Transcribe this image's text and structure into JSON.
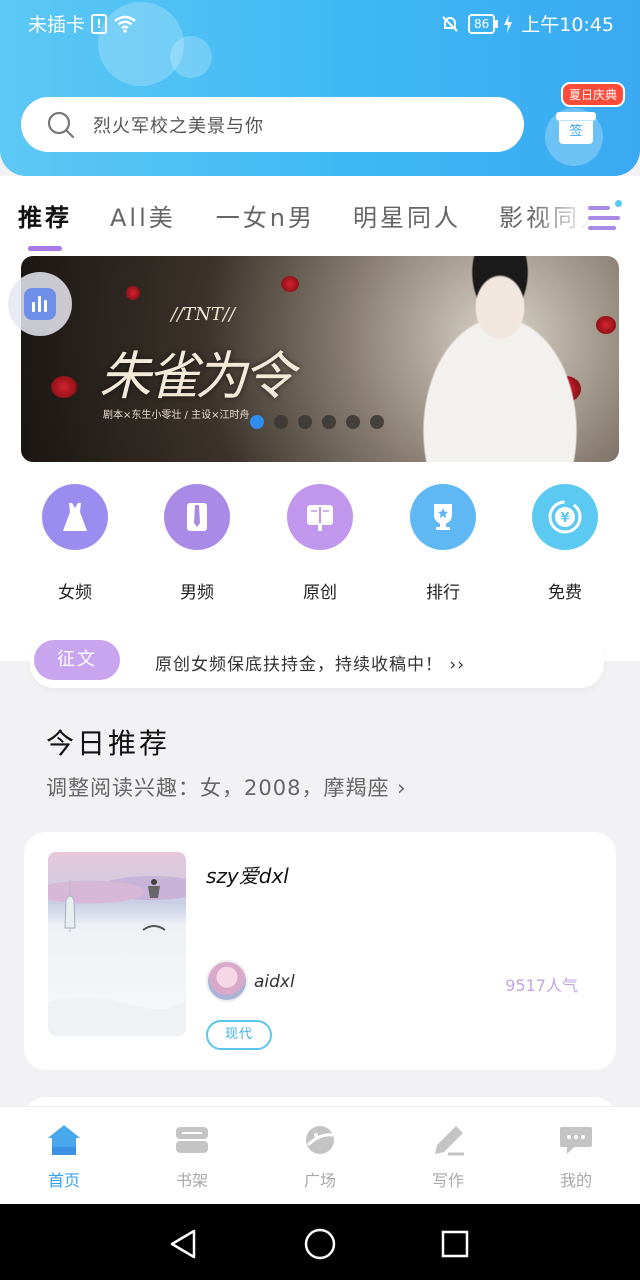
{
  "status_bar": {
    "carrier": "未插卡",
    "battery": "86",
    "time": "上午10:45"
  },
  "search": {
    "placeholder": "烈火军校之美景与你"
  },
  "signin": {
    "badge": "夏日庆典",
    "label": "签"
  },
  "tabs": [
    {
      "label": "推荐"
    },
    {
      "label": "All美"
    },
    {
      "label": "一女n男"
    },
    {
      "label": "明星同人"
    },
    {
      "label": "影视同人"
    }
  ],
  "banner": {
    "tnt": "//TNT//",
    "title": "朱雀为令",
    "credits": "剧本×东生小零壮 / 主设×江时舟"
  },
  "categories": [
    {
      "label": "女频",
      "icon": "dress-icon",
      "color": "#9b8df0"
    },
    {
      "label": "男频",
      "icon": "shirt-icon",
      "color": "#a98ae6"
    },
    {
      "label": "原创",
      "icon": "book-icon",
      "color": "#c197ee"
    },
    {
      "label": "排行",
      "icon": "trophy-icon",
      "color": "#5fb8f4"
    },
    {
      "label": "免费",
      "icon": "yen-coin-icon",
      "color": "#5cc9f2"
    }
  ],
  "notice": {
    "tag": "征文",
    "text": "原创女频保底扶持金，持续收稿中！ ››"
  },
  "recommend": {
    "title": "今日推荐",
    "subtitle": "调整阅读兴趣：女，2008，摩羯座  ›"
  },
  "book": {
    "title": "szy爱dxl",
    "author": "aidxl",
    "popularity": "9517人气",
    "tag": "现代"
  },
  "bottom_nav": [
    {
      "label": "首页",
      "icon": "home-icon"
    },
    {
      "label": "书架",
      "icon": "bookshelf-icon"
    },
    {
      "label": "广场",
      "icon": "planet-icon"
    },
    {
      "label": "写作",
      "icon": "pen-icon"
    },
    {
      "label": "我的",
      "icon": "chat-bubble-icon"
    }
  ],
  "colors": {
    "header_blue": "#3fb8f3",
    "accent_purple": "#a77ae8",
    "nav_active": "#3aa3ee"
  }
}
